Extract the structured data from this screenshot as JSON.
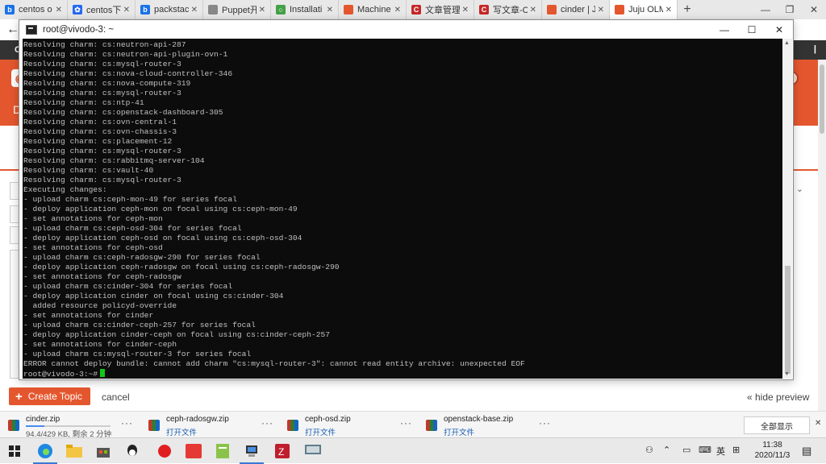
{
  "browser": {
    "tabs": [
      {
        "label": "centos o",
        "color": "#1a73e8",
        "glyph": "b"
      },
      {
        "label": "centos下",
        "color": "#2468f2",
        "glyph": "✿"
      },
      {
        "label": "packstac",
        "color": "#1a73e8",
        "glyph": "b"
      },
      {
        "label": "Puppet开",
        "color": "#888888",
        "glyph": ""
      },
      {
        "label": "Installati",
        "color": "#43a047",
        "glyph": "○"
      },
      {
        "label": "Machine",
        "color": "#e4572e",
        "glyph": ""
      },
      {
        "label": "文章管理",
        "color": "#c62828",
        "glyph": "C"
      },
      {
        "label": "写文章-C",
        "color": "#c62828",
        "glyph": "C"
      },
      {
        "label": "cinder | J",
        "color": "#e4572e",
        "glyph": ""
      },
      {
        "label": "Juju OLM",
        "color": "#e4572e",
        "glyph": ""
      }
    ],
    "new_tab": "+",
    "site_bar_left": "CA",
    "site_bar_right": "|",
    "banner_letter": "D"
  },
  "terminal": {
    "title": "root@vivodo-3: ~",
    "lines": [
      "Resolving charm: cs:neutron-api-287",
      "Resolving charm: cs:neutron-api-plugin-ovn-1",
      "Resolving charm: cs:mysql-router-3",
      "Resolving charm: cs:nova-cloud-controller-346",
      "Resolving charm: cs:nova-compute-319",
      "Resolving charm: cs:mysql-router-3",
      "Resolving charm: cs:ntp-41",
      "Resolving charm: cs:openstack-dashboard-305",
      "Resolving charm: cs:ovn-central-1",
      "Resolving charm: cs:ovn-chassis-3",
      "Resolving charm: cs:placement-12",
      "Resolving charm: cs:mysql-router-3",
      "Resolving charm: cs:rabbitmq-server-104",
      "Resolving charm: cs:vault-40",
      "Resolving charm: cs:mysql-router-3",
      "Executing changes:",
      "- upload charm cs:ceph-mon-49 for series focal",
      "- deploy application ceph-mon on focal using cs:ceph-mon-49",
      "- set annotations for ceph-mon",
      "- upload charm cs:ceph-osd-304 for series focal",
      "- deploy application ceph-osd on focal using cs:ceph-osd-304",
      "- set annotations for ceph-osd",
      "- upload charm cs:ceph-radosgw-290 for series focal",
      "- deploy application ceph-radosgw on focal using cs:ceph-radosgw-290",
      "- set annotations for ceph-radosgw",
      "- upload charm cs:cinder-304 for series focal",
      "- deploy application cinder on focal using cs:cinder-304",
      "  added resource policyd-override",
      "- set annotations for cinder",
      "- upload charm cs:cinder-ceph-257 for series focal",
      "- deploy application cinder-ceph on focal using cs:cinder-ceph-257",
      "- set annotations for cinder-ceph",
      "- upload charm cs:mysql-router-3 for series focal",
      "ERROR cannot deploy bundle: cannot add charm \"cs:mysql-router-3\": cannot read entity archive: unexpected EOF"
    ],
    "prompt": "root@vivodo-3:~#"
  },
  "page": {
    "create_topic": "Create Topic",
    "cancel": "cancel",
    "hide_preview": "« hide preview"
  },
  "downloads": {
    "items": [
      {
        "name": "cinder.zip",
        "sub": "94.4/429 KB, 剩余 2 分钟",
        "progress": 0.22,
        "open": false
      },
      {
        "name": "ceph-radosgw.zip",
        "sub": "打开文件",
        "open": true
      },
      {
        "name": "ceph-osd.zip",
        "sub": "打开文件",
        "open": true
      },
      {
        "name": "openstack-base.zip",
        "sub": "打开文件",
        "open": true
      }
    ],
    "show_all": "全部显示",
    "close": "✕",
    "more": "···"
  },
  "taskbar": {
    "ime": "英",
    "time": "11:38",
    "date": "2020/11/3"
  }
}
